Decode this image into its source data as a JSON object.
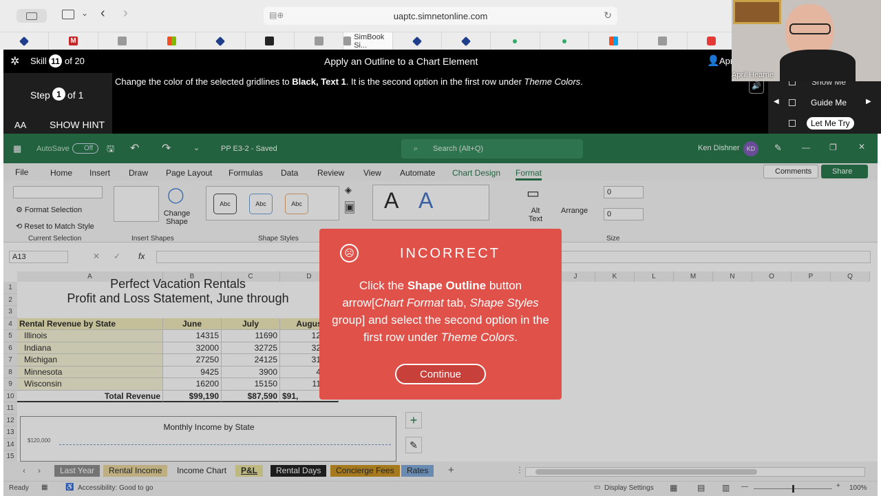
{
  "browser": {
    "url": "uaptc.simnetonline.com",
    "active_tab": "SimBook Si..."
  },
  "simnet": {
    "skill_label": "Skill",
    "skill_number": "11",
    "skill_total": "of 20",
    "skill_title": "Apply an Outline to a Chart Element",
    "user_short": "Apri",
    "step_label": "Step",
    "step_number": "1",
    "step_total": "of 1",
    "text_size": "AA",
    "hint": "SHOW HINT",
    "instruction_pre": "Change the color of the selected gridlines to ",
    "instruction_bold": "Black, Text 1",
    "instruction_mid": ". It is the second option in the first row under ",
    "instruction_italic": "Theme Colors",
    "instruction_end": ".",
    "modes": [
      "Show Me",
      "Guide Me",
      "Let Me Try"
    ],
    "webcam_name": "April Hearne"
  },
  "excel": {
    "autosave": "AutoSave",
    "autosave_state": "Off",
    "filename": "PP E3-2 - Saved",
    "search_placeholder": "Search (Alt+Q)",
    "user": "Ken Dishner",
    "user_initials": "KD",
    "tabs": [
      "File",
      "Home",
      "Insert",
      "Draw",
      "Page Layout",
      "Formulas",
      "Data",
      "Review",
      "View",
      "Automate",
      "Chart Design",
      "Format"
    ],
    "active_tab": "Format",
    "comments": "Comments",
    "share": "Share",
    "ribbon": {
      "format_selection": "Format Selection",
      "reset_style": "Reset to Match Style",
      "current_selection": "Current Selection",
      "insert_shapes": "Insert Shapes",
      "change_shape": "Change Shape",
      "shape_styles": "Shape Styles",
      "abc": "Abc",
      "wordart_a": "A",
      "alt_text": "Alt Text",
      "arrange": "Arrange",
      "size": "Size",
      "height_val": "0",
      "width_val": "0"
    },
    "name_box": "A13",
    "fx": "fx",
    "columns": [
      "A",
      "B",
      "C",
      "D",
      "J",
      "K",
      "L",
      "M",
      "N",
      "O",
      "P",
      "Q"
    ],
    "rows": [
      "1",
      "2",
      "3",
      "4",
      "5",
      "6",
      "7",
      "8",
      "9",
      "10",
      "11",
      "12",
      "13",
      "14",
      "15"
    ],
    "sheet": {
      "title1": "Perfect Vacation Rentals",
      "title2": "Profit and Loss Statement, June through",
      "header": [
        "Rental Revenue by State",
        "June",
        "July",
        "Augus"
      ],
      "data": [
        [
          "Illinois",
          "14315",
          "11690",
          "12"
        ],
        [
          "Indiana",
          "32000",
          "32725",
          "32"
        ],
        [
          "Michigan",
          "27250",
          "24125",
          "31"
        ],
        [
          "Minnesota",
          "9425",
          "3900",
          "4"
        ],
        [
          "Wisconsin",
          "16200",
          "15150",
          "11"
        ]
      ],
      "total": [
        "Total Revenue",
        "$99,190",
        "$87,590",
        "$91,"
      ]
    },
    "chart": {
      "title": "Monthly Income by State",
      "tick": "$120,000"
    },
    "sheet_tabs": [
      {
        "label": "Last Year",
        "color": "#8a8a8a",
        "text": "#fff"
      },
      {
        "label": "Rental Income",
        "color": "#e7d59a",
        "text": "#222"
      },
      {
        "label": "Income Chart",
        "color": "#f3f3f3",
        "text": "#222"
      },
      {
        "label": "P&L",
        "color": "#e7e29a",
        "text": "#222"
      },
      {
        "label": "Rental Days",
        "color": "#1a1a1a",
        "text": "#fff"
      },
      {
        "label": "Concierge Fees",
        "color": "#c8901c",
        "text": "#222"
      },
      {
        "label": "Rates",
        "color": "#7ba7d8",
        "text": "#222"
      }
    ],
    "status_ready": "Ready",
    "accessibility": "Accessibility: Good to go",
    "display_settings": "Display Settings",
    "zoom": "100%"
  },
  "modal": {
    "title": "INCORRECT",
    "msg_1": "Click the ",
    "msg_bold": "Shape Outline",
    "msg_2": " button arrow[",
    "msg_it1": "Chart Format",
    "msg_3": " tab, ",
    "msg_it2": "Shape Styles",
    "msg_4": " group] and select the second option in the first row under ",
    "msg_it3": "Theme Colors",
    "msg_5": ".",
    "button": "Continue"
  }
}
